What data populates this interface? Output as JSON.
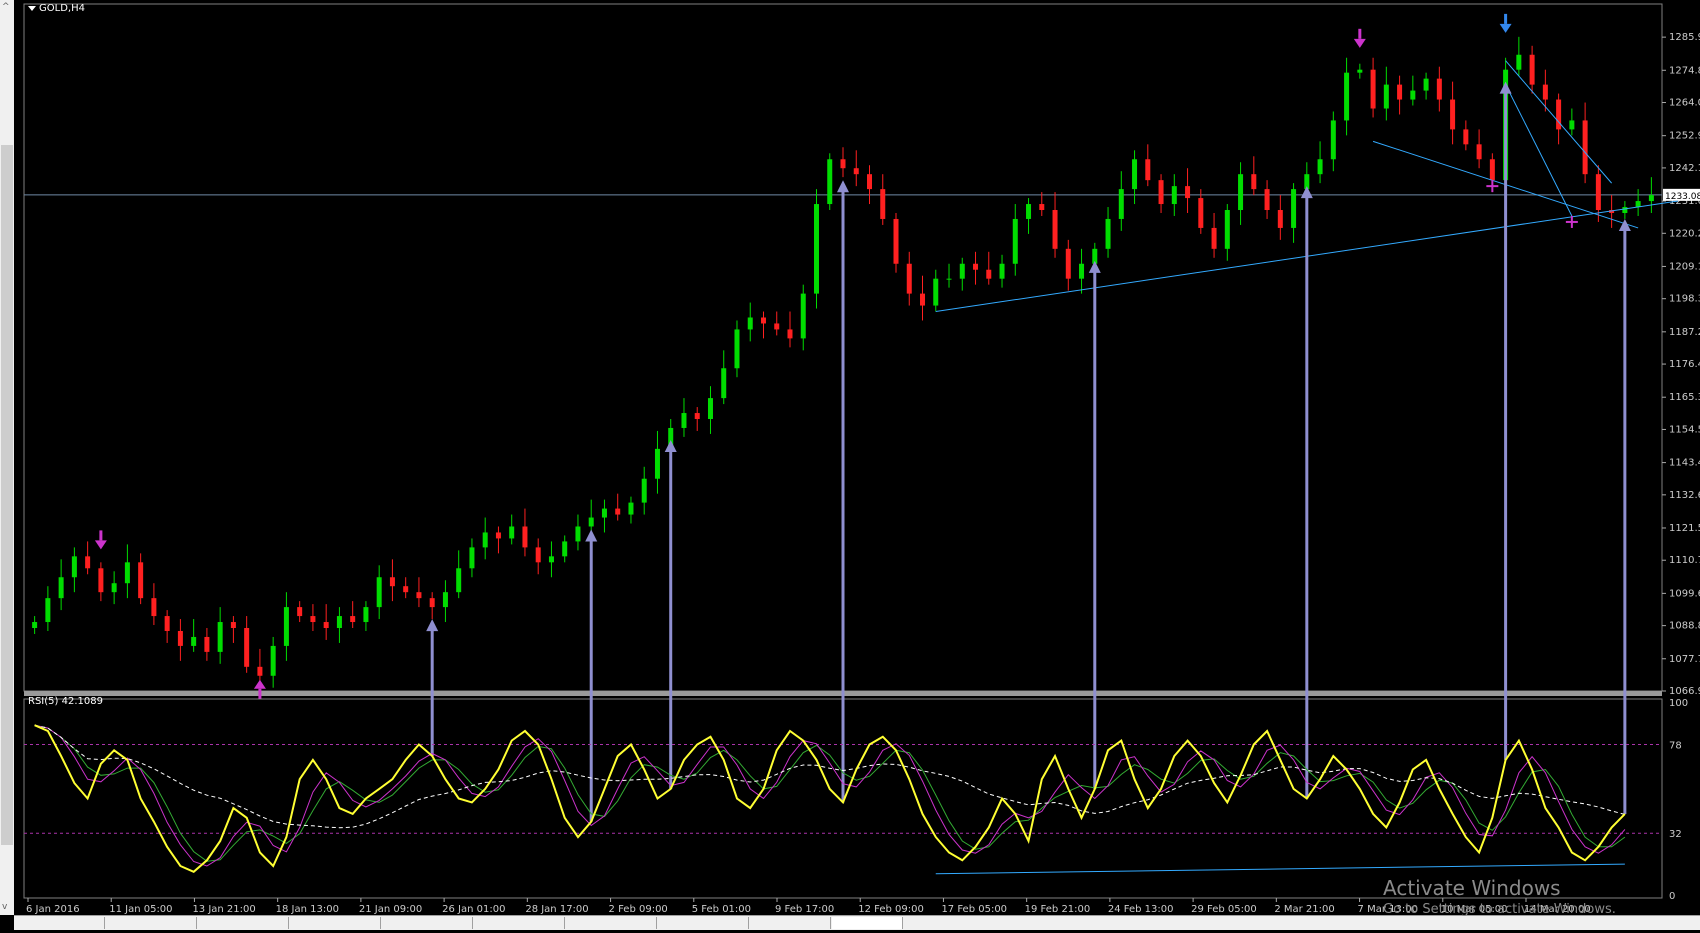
{
  "chart_data": [
    {
      "type": "candlestick",
      "symbol_label": "GOLD,H4",
      "ylim": [
        1066.9,
        1297.0
      ],
      "y_ticks": [
        "1285.90",
        "1274.80",
        "1264.00",
        "1252.90",
        "1242.10",
        "1231.00",
        "1220.20",
        "1209.10",
        "1198.30",
        "1187.20",
        "1176.40",
        "1165.30",
        "1154.50",
        "1143.40",
        "1132.60",
        "1121.50",
        "1110.70",
        "1099.60",
        "1088.80",
        "1077.70",
        "1066.90"
      ],
      "current_price": "1233.08",
      "hline_price": 1233.08,
      "x_tick_labels": [
        "6 Jan 2016",
        "11 Jan 05:00",
        "13 Jan 21:00",
        "18 Jan 13:00",
        "21 Jan 09:00",
        "26 Jan 01:00",
        "28 Jan 17:00",
        "2 Feb 09:00",
        "5 Feb 01:00",
        "9 Feb 17:00",
        "12 Feb 09:00",
        "17 Feb 05:00",
        "19 Feb 21:00",
        "24 Feb 13:00",
        "29 Feb 05:00",
        "2 Mar 21:00",
        "7 Mar 13:00",
        "10 Mar 05:00",
        "14 Mar 20:00"
      ],
      "close_path": [
        1090,
        1098,
        1105,
        1112,
        1108,
        1100,
        1103,
        1110,
        1098,
        1092,
        1087,
        1082,
        1085,
        1080,
        1090,
        1088,
        1075,
        1072,
        1082,
        1095,
        1092,
        1090,
        1088,
        1092,
        1090,
        1095,
        1105,
        1102,
        1100,
        1098,
        1095,
        1100,
        1108,
        1115,
        1120,
        1118,
        1122,
        1115,
        1110,
        1112,
        1117,
        1122,
        1125,
        1128,
        1126,
        1130,
        1138,
        1148,
        1155,
        1160,
        1158,
        1165,
        1175,
        1188,
        1192,
        1190,
        1188,
        1185,
        1200,
        1230,
        1245,
        1242,
        1240,
        1235,
        1225,
        1210,
        1200,
        1196,
        1205,
        1205,
        1210,
        1208,
        1205,
        1210,
        1225,
        1230,
        1228,
        1215,
        1205,
        1210,
        1215,
        1225,
        1235,
        1245,
        1238,
        1230,
        1236,
        1232,
        1222,
        1215,
        1228,
        1240,
        1235,
        1228,
        1222,
        1235,
        1240,
        1245,
        1258,
        1274,
        1275,
        1262,
        1270,
        1265,
        1268,
        1272,
        1265,
        1255,
        1250,
        1245,
        1238,
        1275,
        1280,
        1270,
        1265,
        1255,
        1258,
        1240,
        1228,
        1227,
        1229,
        1231,
        1233
      ],
      "markers": [
        {
          "type": "down-arrow",
          "color": "#cc33cc",
          "index": 5,
          "price": 1116
        },
        {
          "type": "up-arrow",
          "color": "#cc33cc",
          "index": 17,
          "price": 1069
        },
        {
          "type": "down-arrow",
          "color": "#cc33cc",
          "index": 100,
          "price": 1284
        },
        {
          "type": "down-arrow",
          "color": "#3388ee",
          "index": 111,
          "price": 1289
        },
        {
          "type": "cross",
          "color": "#cc33cc",
          "index": 110,
          "price": 1236
        },
        {
          "type": "cross",
          "color": "#cc33cc",
          "index": 116,
          "price": 1224
        }
      ],
      "trendlines": [
        {
          "p1": [
            68,
            1194
          ],
          "p2": [
            124,
            1231
          ],
          "color": "#33aaff"
        },
        {
          "p1": [
            101,
            1251
          ],
          "p2": [
            121,
            1222
          ],
          "color": "#33aaff"
        },
        {
          "p1": [
            111,
            1278
          ],
          "p2": [
            119,
            1237
          ],
          "color": "#33aaff"
        },
        {
          "p1": [
            111,
            1270
          ],
          "p2": [
            116,
            1226
          ],
          "color": "#33aaff"
        }
      ],
      "divergence_arrows_index": [
        30,
        42,
        48,
        61,
        80,
        96,
        111,
        120
      ]
    },
    {
      "type": "line",
      "indicator_label": "RSI(5) 42.1089",
      "ylim": [
        0,
        100
      ],
      "y_ticks": [
        "100",
        "78",
        "32",
        "0"
      ],
      "levels": [
        78,
        32
      ],
      "rsi": [
        88,
        85,
        72,
        58,
        50,
        68,
        75,
        70,
        50,
        38,
        25,
        15,
        12,
        18,
        28,
        45,
        40,
        22,
        15,
        30,
        60,
        70,
        60,
        45,
        42,
        50,
        55,
        60,
        70,
        78,
        72,
        60,
        50,
        48,
        55,
        65,
        80,
        85,
        78,
        60,
        40,
        30,
        38,
        55,
        72,
        78,
        65,
        50,
        55,
        70,
        78,
        82,
        70,
        50,
        45,
        55,
        75,
        85,
        80,
        70,
        55,
        48,
        65,
        78,
        82,
        75,
        60,
        42,
        30,
        22,
        18,
        25,
        35,
        50,
        42,
        28,
        60,
        72,
        55,
        40,
        55,
        75,
        80,
        60,
        45,
        55,
        72,
        80,
        72,
        58,
        48,
        62,
        78,
        85,
        70,
        55,
        50,
        60,
        72,
        65,
        55,
        42,
        35,
        48,
        65,
        70,
        55,
        42,
        30,
        22,
        40,
        70,
        80,
        65,
        45,
        35,
        22,
        18,
        25,
        35,
        42
      ],
      "series_colors": [
        "#ffff33",
        "#cc33cc",
        "#33aa33",
        "#ffffff"
      ],
      "support_line": {
        "p1": [
          68,
          11
        ],
        "p2": [
          120,
          16
        ],
        "color": "#33aaff"
      }
    }
  ],
  "watermark": {
    "line1": "Activate Windows",
    "line2": "Go to Settings to activate Windows."
  }
}
